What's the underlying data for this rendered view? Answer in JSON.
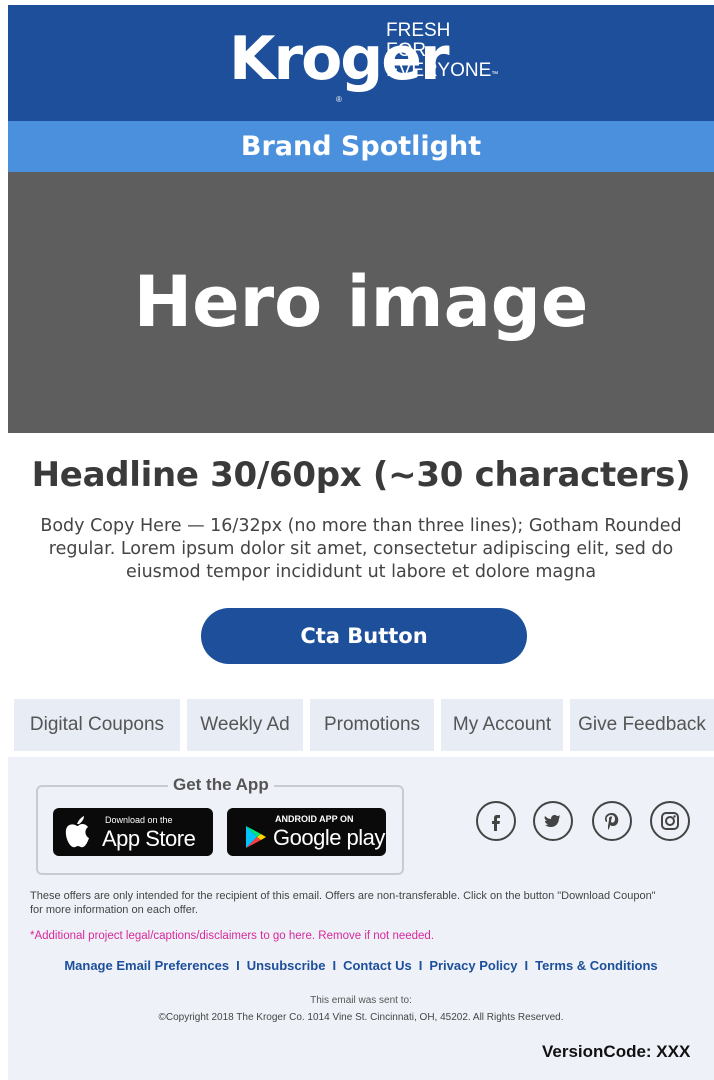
{
  "header": {
    "logo_text": "Kroger",
    "logo_mark": "®",
    "tagline": [
      "FRESH",
      "FOR",
      "EVERYONE"
    ],
    "tagline_tm": "™"
  },
  "spotlight": {
    "label": "Brand Spotlight"
  },
  "hero": {
    "label": "Hero image"
  },
  "content": {
    "headline": "Headline 30/60px (~30 characters)",
    "body": "Body Copy Here — 16/32px (no more than three lines); Gotham Rounded regular. Lorem ipsum dolor sit amet, consectetur adipiscing elit, sed do eiusmod tempor incididunt ut labore et dolore magna",
    "cta_label": "Cta Button"
  },
  "nav": {
    "items": [
      "Digital Coupons",
      "Weekly Ad",
      "Promotions",
      "My Account",
      "Give Feedback"
    ]
  },
  "app": {
    "title": "Get the App",
    "apple_small": "Download on the",
    "apple_big": "App Store",
    "google_small": "ANDROID APP ON",
    "google_big": "Google play"
  },
  "social": {
    "icons": [
      "facebook-icon",
      "twitter-icon",
      "pinterest-icon",
      "instagram-icon"
    ]
  },
  "footer": {
    "legal": "These offers are only intended for the recipient of this email. Offers are non-transferable. Click on the button \"Download Coupon\" for more information on each offer.",
    "disclaimer": "*Additional project legal/captions/disclaimers to go here. Remove if not needed.",
    "links": [
      "Manage Email Preferences",
      "Unsubscribe",
      "Contact Us",
      "Privacy Policy",
      "Terms & Conditions"
    ],
    "separator": "I",
    "sent_to": "This email was sent to:",
    "copyright": "©Copyright 2018 The Kroger Co. 1014 Vine St. Cincinnati, OH, 45202. All Rights Reserved.",
    "version": "VersionCode: XXX"
  },
  "colors": {
    "brand_blue": "#1d4f9a",
    "bar_blue": "#4a90dc",
    "hero_gray": "#5e5e5e",
    "disclaimer_pink": "#d8289b"
  }
}
